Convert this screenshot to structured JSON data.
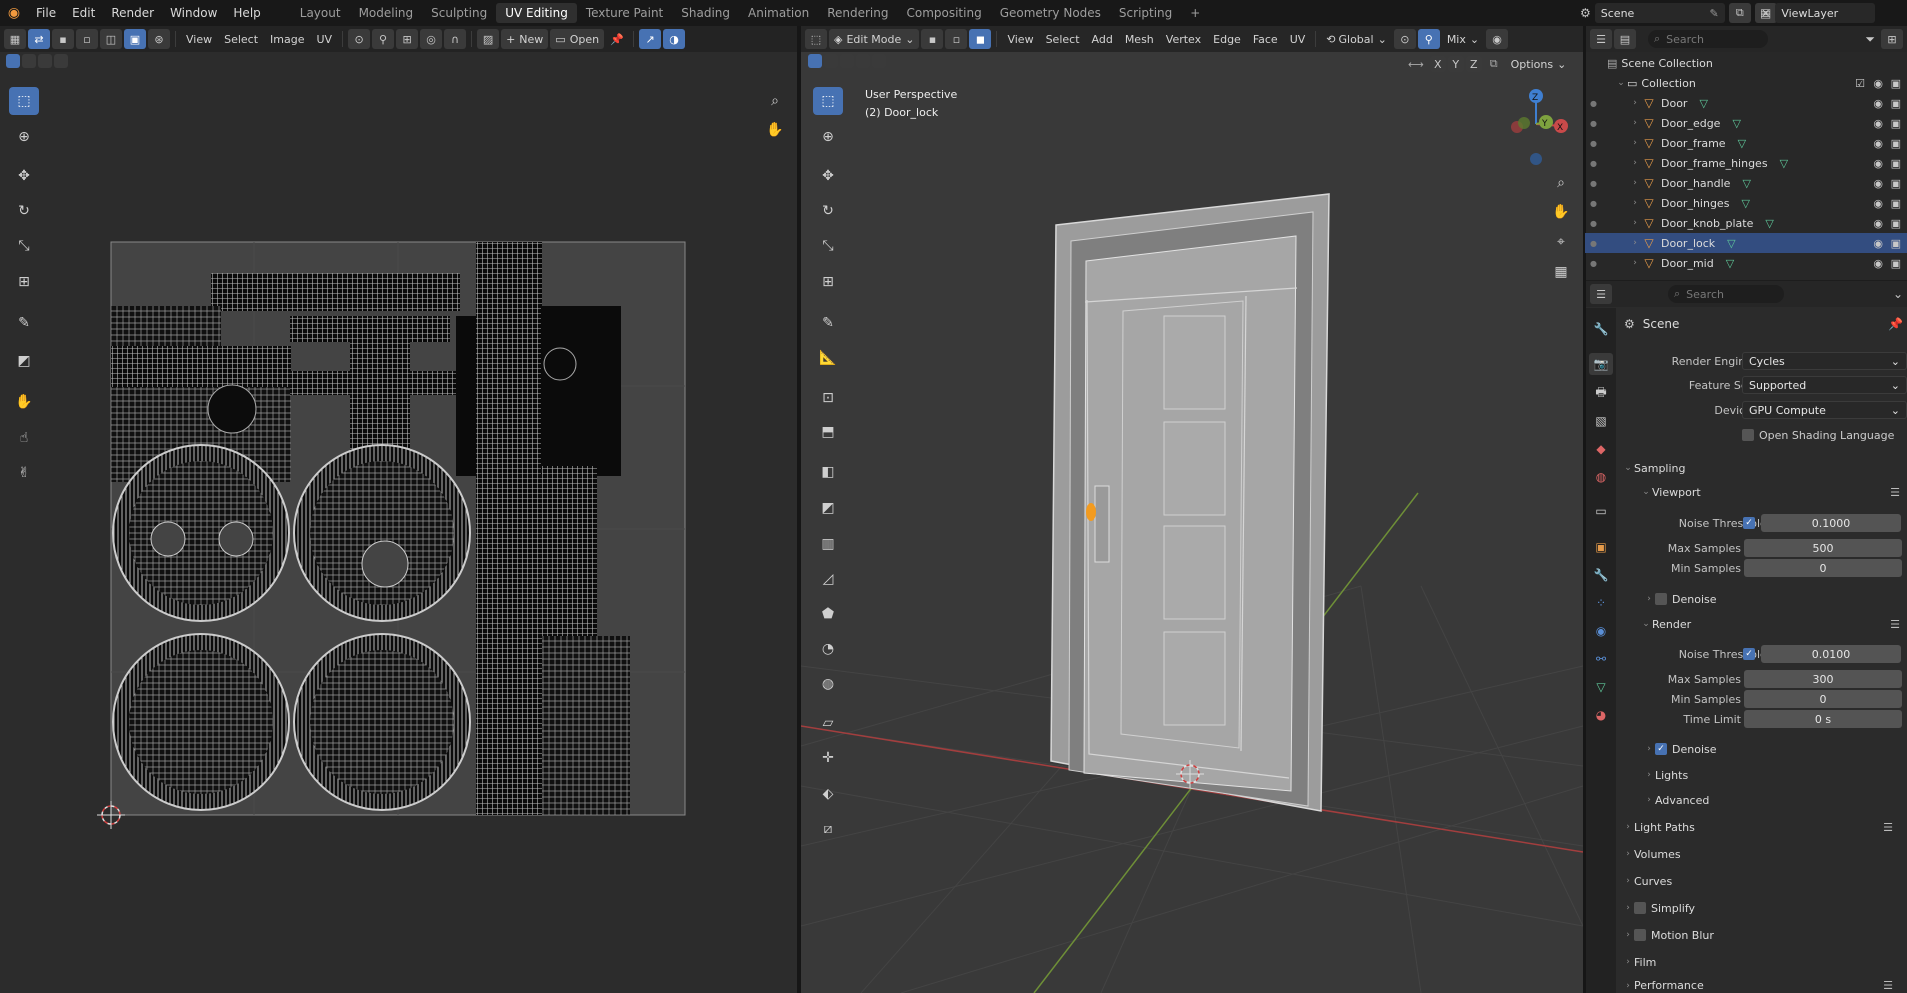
{
  "topbar": {
    "menus": [
      "File",
      "Edit",
      "Render",
      "Window",
      "Help"
    ],
    "workspaces": [
      "Layout",
      "Modeling",
      "Sculpting",
      "UV Editing",
      "Texture Paint",
      "Shading",
      "Animation",
      "Rendering",
      "Compositing",
      "Geometry Nodes",
      "Scripting"
    ],
    "active_workspace": "UV Editing",
    "add_workspace": "+",
    "scene_name": "Scene",
    "view_layer_name": "ViewLayer"
  },
  "uv_editor": {
    "menus": [
      "View",
      "Select",
      "Image",
      "UV"
    ],
    "new_label": "New",
    "open_label": "Open"
  },
  "viewport": {
    "mode": "Edit Mode",
    "menus": [
      "View",
      "Select",
      "Add",
      "Mesh",
      "Vertex",
      "Edge",
      "Face",
      "UV"
    ],
    "transform_orientation": "Global",
    "shading_label": "Mix",
    "axes": [
      "X",
      "Y",
      "Z"
    ],
    "options_label": "Options",
    "overlay_title": "User Perspective",
    "overlay_object": "(2) Door_lock",
    "gizmo_axes": {
      "x": "X",
      "y": "Y",
      "z": "Z"
    }
  },
  "outliner": {
    "search_placeholder": "Search",
    "scene_collection": "Scene Collection",
    "collection": "Collection",
    "items": [
      "Door",
      "Door_edge",
      "Door_frame",
      "Door_frame_hinges",
      "Door_handle",
      "Door_hinges",
      "Door_knob_plate",
      "Door_lock",
      "Door_mid"
    ],
    "selected": "Door_lock"
  },
  "properties": {
    "search_placeholder": "Search",
    "context_title": "Scene",
    "render_engine_label": "Render Engine",
    "render_engine": "Cycles",
    "feature_set_label": "Feature Set",
    "feature_set": "Supported",
    "device_label": "Device",
    "device": "GPU Compute",
    "osl_label": "Open Shading Language",
    "sampling": "Sampling",
    "viewport_sub": "Viewport",
    "noise_threshold_label": "Noise Threshold",
    "viewport_noise": "0.1000",
    "max_samples_label": "Max Samples",
    "viewport_max": "500",
    "min_samples_label": "Min Samples",
    "viewport_min": "0",
    "denoise_label": "Denoise",
    "render_sub": "Render",
    "render_noise": "0.0100",
    "render_max": "300",
    "render_min": "0",
    "time_limit_label": "Time Limit",
    "time_limit": "0 s",
    "lights": "Lights",
    "advanced": "Advanced",
    "light_paths": "Light Paths",
    "volumes": "Volumes",
    "curves": "Curves",
    "simplify": "Simplify",
    "motion_blur": "Motion Blur",
    "film": "Film",
    "performance": "Performance"
  },
  "colors": {
    "accent": "#4772b3",
    "selection": "#334d80",
    "mesh_icon": "#e49a4a",
    "x_axis": "#c94a4a",
    "y_axis": "#7ea23f",
    "z_axis": "#3f7fd1"
  }
}
